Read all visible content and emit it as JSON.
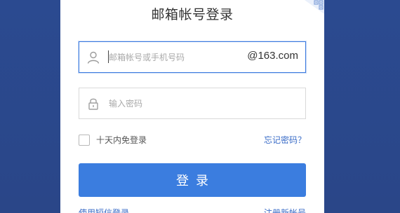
{
  "login": {
    "title": "邮箱帐号登录",
    "account": {
      "placeholder": "邮箱帐号或手机号码",
      "suffix": "@163.com"
    },
    "password": {
      "placeholder": "输入密码"
    },
    "remember_label": "十天内免登录",
    "forgot_link": "忘记密码？",
    "login_button": "登录",
    "bottom_links": {
      "left": "使用短信登录",
      "right": "注册新帐号"
    }
  },
  "colors": {
    "background": "#2c4a8f",
    "accent": "#3b7ddf",
    "link": "#3a6cc7"
  },
  "icons": {
    "account": "user-icon",
    "password": "lock-icon",
    "corner": "qr-code-icon"
  }
}
